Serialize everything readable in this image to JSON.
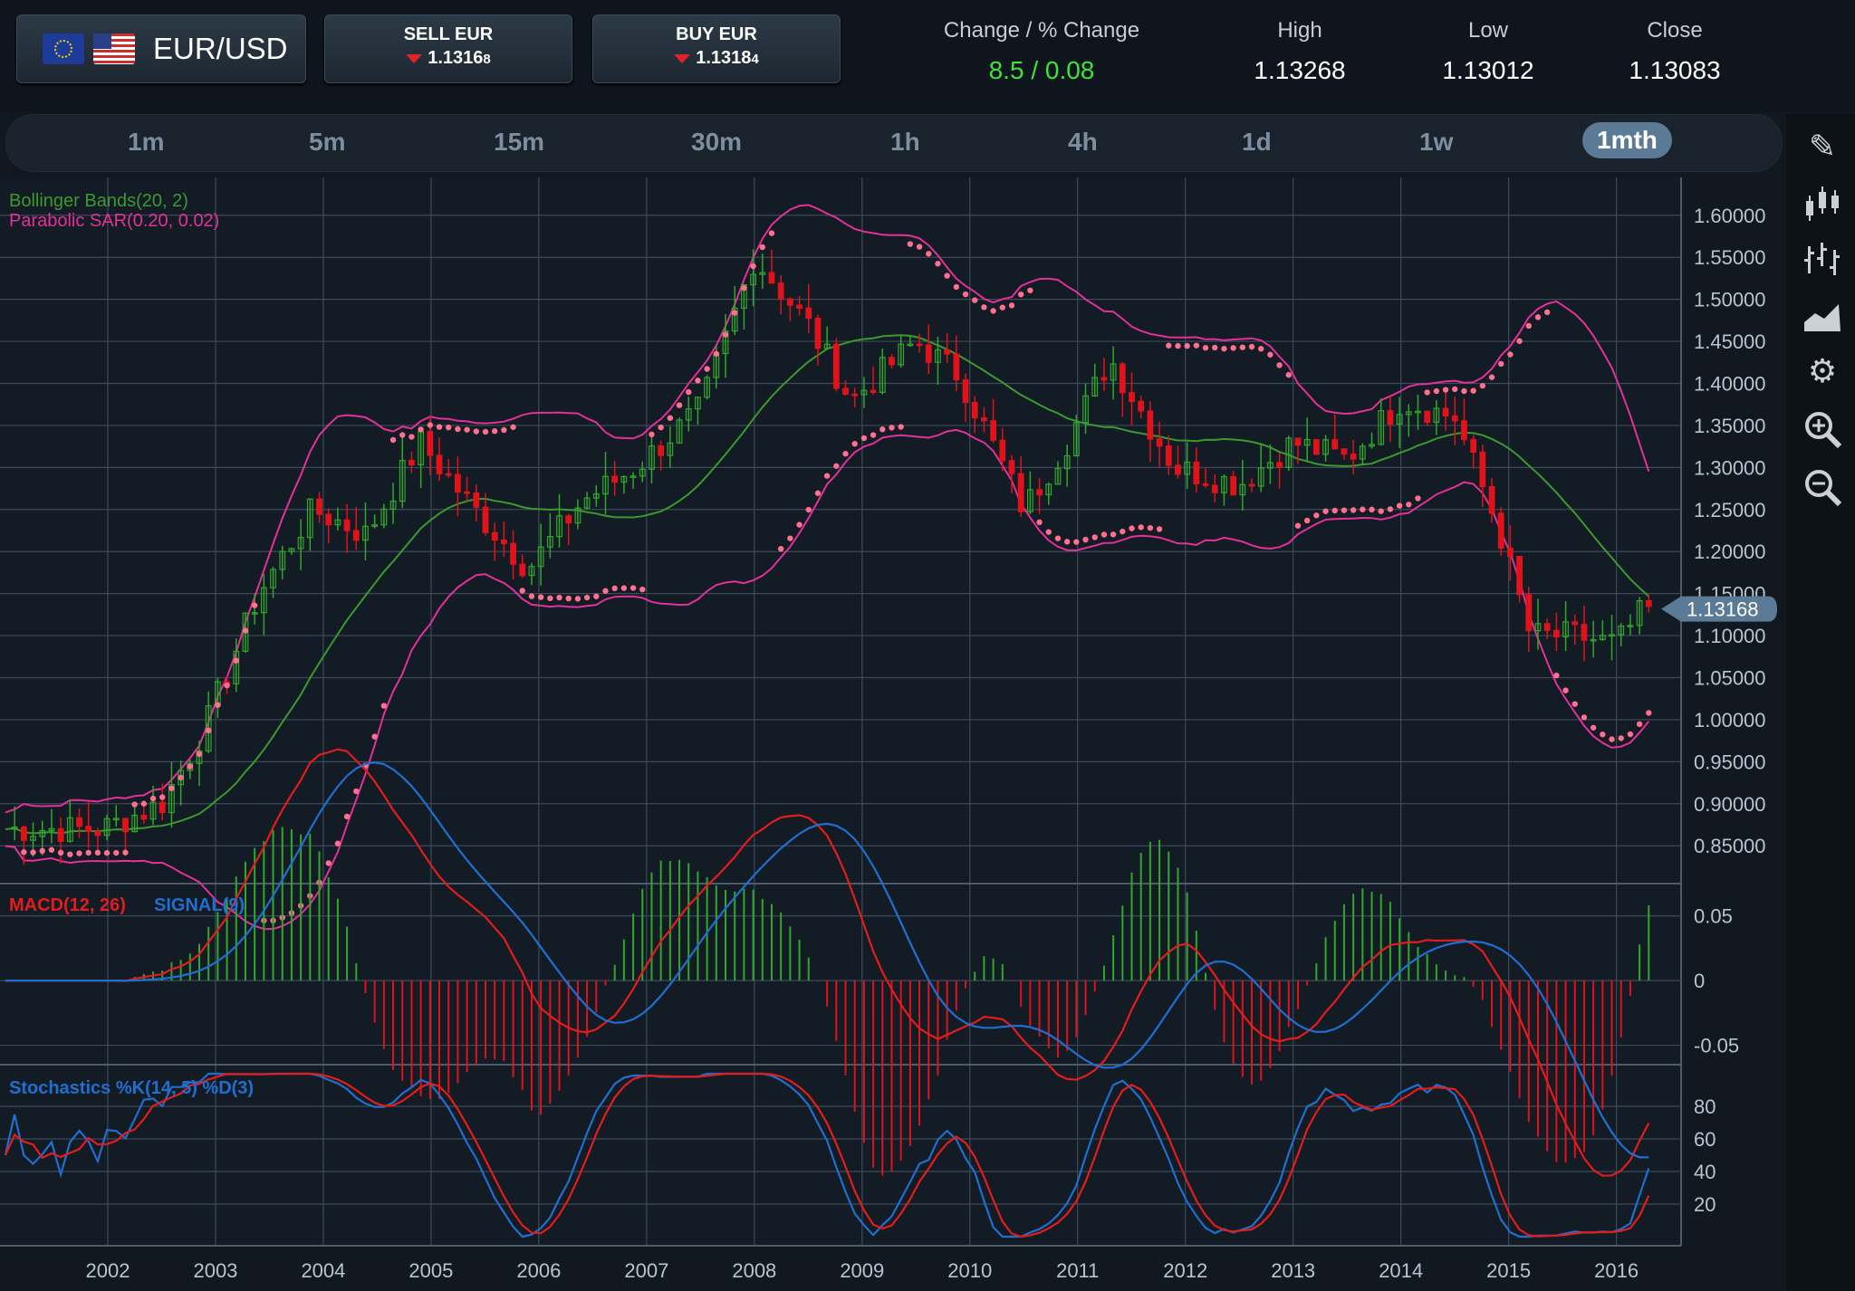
{
  "header": {
    "pair": "EUR/USD",
    "sell": {
      "title": "SELL EUR",
      "price_main": "1.1316",
      "price_pip": "8"
    },
    "buy": {
      "title": "BUY EUR",
      "price_main": "1.1318",
      "price_pip": "4"
    },
    "change_label": "Change / % Change",
    "change_value": "8.5 / 0.08",
    "high_label": "High",
    "high_value": "1.13268",
    "low_label": "Low",
    "low_value": "1.13012",
    "close_label": "Close",
    "close_value": "1.13083"
  },
  "timeframes": [
    "1m",
    "5m",
    "15m",
    "30m",
    "1h",
    "4h",
    "1d",
    "1w",
    "1mth"
  ],
  "active_timeframe": "1mth",
  "toolbar_icons": [
    "pencil-icon",
    "candlestick-icon",
    "bar-chart-icon",
    "area-chart-icon",
    "settings-icon",
    "zoom-in-icon",
    "zoom-out-icon"
  ],
  "colors": {
    "bull": "#2fa82b",
    "bear": "#e2121b",
    "bollinger_bands": "#e3309a",
    "bollinger_mid": "#3a9a2f",
    "sar": "#ff6f8f",
    "macd": "#e41c1c",
    "signal": "#1f6fd1"
  },
  "chart_data": {
    "type": "candlestick",
    "indicators": {
      "bollinger": "Bollinger Bands(20, 2)",
      "sar": "Parabolic SAR(0.20, 0.02)"
    },
    "y_ticks": [
      "1.60000",
      "1.55000",
      "1.50000",
      "1.45000",
      "1.40000",
      "1.35000",
      "1.30000",
      "1.25000",
      "1.20000",
      "1.15000",
      "1.10000",
      "1.05000",
      "1.00000",
      "0.95000",
      "0.90000",
      "0.85000"
    ],
    "ylim": [
      0.805,
      1.645
    ],
    "current_price": "1.13168",
    "x_ticks": [
      "2002",
      "2003",
      "2004",
      "2005",
      "2006",
      "2007",
      "2008",
      "2009",
      "2010",
      "2011",
      "2012",
      "2013",
      "2014",
      "2015",
      "2016"
    ],
    "close_series_keypoints": [
      [
        2001.95,
        0.87
      ],
      [
        2002.5,
        0.9
      ],
      [
        2002.9,
        0.99
      ],
      [
        2003.4,
        1.15
      ],
      [
        2003.9,
        1.25
      ],
      [
        2004.4,
        1.22
      ],
      [
        2004.9,
        1.33
      ],
      [
        2005.4,
        1.25
      ],
      [
        2005.9,
        1.18
      ],
      [
        2006.4,
        1.26
      ],
      [
        2006.9,
        1.3
      ],
      [
        2007.5,
        1.37
      ],
      [
        2008.0,
        1.55
      ],
      [
        2008.5,
        1.47
      ],
      [
        2008.9,
        1.38
      ],
      [
        2009.5,
        1.45
      ],
      [
        2009.9,
        1.41
      ],
      [
        2010.5,
        1.25
      ],
      [
        2010.9,
        1.33
      ],
      [
        2011.3,
        1.43
      ],
      [
        2011.9,
        1.3
      ],
      [
        2012.5,
        1.28
      ],
      [
        2013.0,
        1.33
      ],
      [
        2013.5,
        1.31
      ],
      [
        2014.0,
        1.38
      ],
      [
        2014.5,
        1.36
      ],
      [
        2014.9,
        1.23
      ],
      [
        2015.2,
        1.1
      ],
      [
        2015.6,
        1.1
      ],
      [
        2016.0,
        1.09
      ],
      [
        2016.25,
        1.13
      ]
    ],
    "macd": {
      "label": "MACD(12, 26)",
      "signal_label": "SIGNAL(9)",
      "y_ticks": [
        "0.05",
        "0",
        "-0.05"
      ],
      "ylim": [
        -0.065,
        0.075
      ]
    },
    "stochastics": {
      "label": "Stochastics %K(14, 5) %D(3)",
      "y_ticks": [
        "80",
        "60",
        "40",
        "20"
      ],
      "ylim": [
        0,
        100
      ]
    }
  }
}
